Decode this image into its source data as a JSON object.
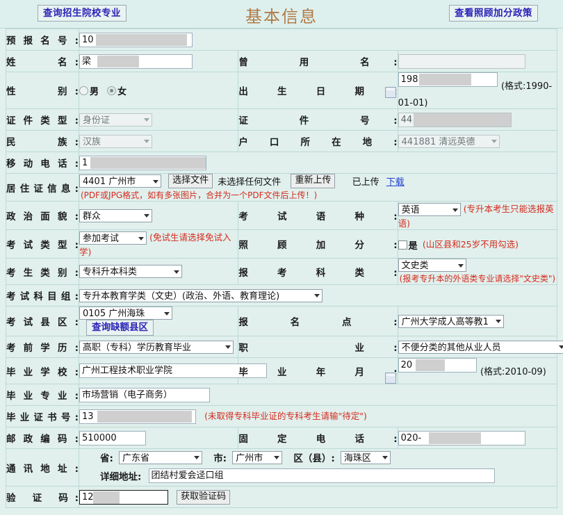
{
  "header": {
    "left_button": "查询招生院校专业",
    "title": "基本信息",
    "right_button": "查看照顾加分政策"
  },
  "colors": {
    "page_bg": "#e3f1ee",
    "label_bg": "#d9ece9",
    "border": "#bcd9d5",
    "title": "#b07b4a",
    "link": "#2b23b8",
    "hint_red": "#d52b1e"
  },
  "fields": {
    "pre_reg_no": {
      "label": "预报名号:",
      "value": "10"
    },
    "name": {
      "label": "姓　　名:",
      "value": "梁"
    },
    "former_name": {
      "label": "曾 用 名:",
      "value": ""
    },
    "gender": {
      "label": "性　　别:",
      "male": "男",
      "female": "女",
      "selected": "女"
    },
    "birth_date": {
      "label": "出生日期:",
      "value": "198",
      "format_hint": "(格式:1990-01-01)"
    },
    "id_type": {
      "label": "证件类型:",
      "value": "身份证"
    },
    "id_no": {
      "label": "证 件 号:",
      "value": "44"
    },
    "nation": {
      "label": "民　　族:",
      "value": "汉族"
    },
    "hukou": {
      "label": "户口所在地:",
      "value": "441881 清远英德"
    },
    "mobile": {
      "label": "移动电话:",
      "value": "1"
    },
    "residence_permit": {
      "label": "居住证信息:",
      "city": "4401 广州市",
      "choose_file_btn": "选择文件",
      "no_file_text": "未选择任何文件",
      "reupload_btn": "重新上传",
      "uploaded_text": "已上传",
      "download_link": "下载",
      "hint": "(PDF或JPG格式，如有多张图片，合并为一个PDF文件后上传！)"
    },
    "political": {
      "label": "政治面貌:",
      "value": "群众"
    },
    "exam_language": {
      "label": "考试语种:",
      "value": "英语",
      "hint": "(专升本考生只能选报英语)"
    },
    "exam_type": {
      "label": "考试类型:",
      "value": "参加考试",
      "hint": "(免试生请选择免试入学)"
    },
    "bonus_points": {
      "label": "照顾加分:",
      "checkbox_label": "是",
      "checked": false,
      "hint": "(山区县和25岁不用勾选)"
    },
    "candidate_category": {
      "label": "考生类别:",
      "value": "专科升本科类"
    },
    "apply_category": {
      "label": "报考科类:",
      "value": "文史类",
      "hint": "(报考专升本的外语类专业请选择\"文史类\")"
    },
    "subject_group": {
      "label": "考试科目组:",
      "value": "专升本教育学类（文史）(政治、外语、教育理论)"
    },
    "exam_county": {
      "label": "考试县区:",
      "value": "0105 广州海珠",
      "query_btn": "查询缺额县区"
    },
    "reg_point": {
      "label": "报名点:",
      "value": "广州大学成人高等教1"
    },
    "prior_education": {
      "label": "考前学历:",
      "value": "高职（专科）学历教育毕业"
    },
    "occupation": {
      "label": "职　　业:",
      "value": "不便分类的其他从业人员"
    },
    "grad_school": {
      "label": "毕业学校:",
      "value": "广州工程技术职业学院"
    },
    "grad_date": {
      "label": "毕业年月:",
      "value": "20",
      "format_hint": "(格式:2010-09)"
    },
    "grad_major": {
      "label": "毕业专业:",
      "value": "市场营销（电子商务）"
    },
    "diploma_no": {
      "label": "毕业证书号:",
      "value": "13",
      "hint": "(未取得专科毕业证的专科考生请输\"待定\")"
    },
    "postcode": {
      "label": "邮政编码:",
      "value": "510000"
    },
    "landline": {
      "label": "固定电话:",
      "value": "020-"
    },
    "address": {
      "label": "通讯地址:",
      "province_label": "省:",
      "province": "广东省",
      "city_label": "市:",
      "city": "广州市",
      "district_label": "区（县）:",
      "district": "海珠区",
      "detail_label": "详细地址:",
      "detail": "团结村爱会迳口组"
    },
    "captcha": {
      "label": "验 证 码:",
      "value": "12",
      "get_btn": "获取验证码"
    }
  }
}
